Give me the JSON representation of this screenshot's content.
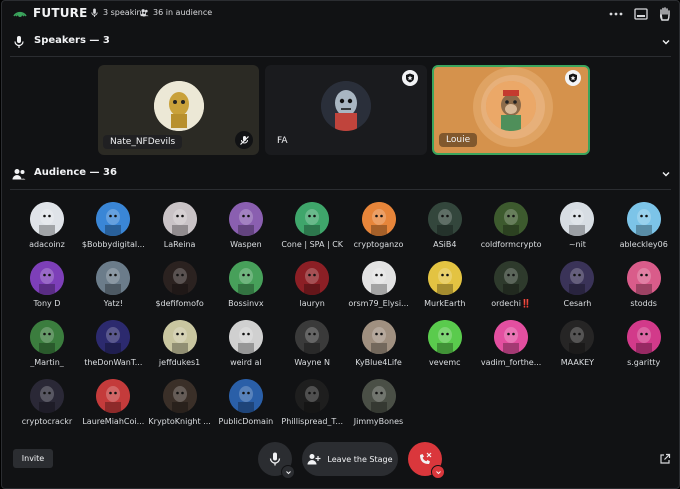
{
  "topbar": {
    "app_name": "FUTURE",
    "speaking": "3 speaking",
    "audience_count": "36 in audience"
  },
  "speakers_section": {
    "title": "Speakers — 3"
  },
  "speakers": [
    {
      "name": "Nate_NFDevils",
      "muted": true,
      "moderator": false,
      "background": "#2b2a24",
      "avatar_color": "#e8e2c8",
      "active": false
    },
    {
      "name": "FA",
      "muted": false,
      "moderator": true,
      "background": "#1a1b1e",
      "avatar_color": "#2a2f3a",
      "active": false
    },
    {
      "name": "Louie",
      "muted": false,
      "moderator": true,
      "background": "#d5924c",
      "avatar_color": "#e8a25e",
      "active": true,
      "active_border": "#3ba55d"
    }
  ],
  "audience_section": {
    "title": "Audience — 36"
  },
  "audience": [
    {
      "name": "adacoinz",
      "color": "#dfe3e8"
    },
    {
      "name": "$Bobbydigital...",
      "color": "#3a86d6"
    },
    {
      "name": "LaReina",
      "color": "#c9c3c6"
    },
    {
      "name": "Waspen",
      "color": "#8a5fb0"
    },
    {
      "name": "Cone | SPA | CK",
      "color": "#3fa66b"
    },
    {
      "name": "cryptoganzo",
      "color": "#e7853a"
    },
    {
      "name": "ASiB4",
      "color": "#33463c"
    },
    {
      "name": "coldformcrypto",
      "color": "#3d5a2e"
    },
    {
      "name": "~nit",
      "color": "#d7dde3"
    },
    {
      "name": "ableckley06",
      "color": "#7cc4e8"
    },
    {
      "name": "Tony D",
      "color": "#7d3fb8"
    },
    {
      "name": "Yatz!",
      "color": "#6b7c8a"
    },
    {
      "name": "$defifomofo",
      "color": "#2b2220"
    },
    {
      "name": "Bossinvx",
      "color": "#47a05a"
    },
    {
      "name": "lauryn",
      "color": "#8c1f25"
    },
    {
      "name": "orsm79_Elysi...",
      "color": "#e2e2e2"
    },
    {
      "name": "MurkEarth",
      "color": "#e3c342"
    },
    {
      "name": "ordechi‼️",
      "color": "#2e3a2c"
    },
    {
      "name": "Cesarh",
      "color": "#3a3358"
    },
    {
      "name": "stodds",
      "color": "#d95c8a"
    },
    {
      "name": "_Martin_",
      "color": "#3b7d3e"
    },
    {
      "name": "theDonWanT...",
      "color": "#2c2a6e"
    },
    {
      "name": "jeffdukes1",
      "color": "#c9c6a0"
    },
    {
      "name": "weird al",
      "color": "#d0d0d0"
    },
    {
      "name": "Wayne N",
      "color": "#3a3a3a"
    },
    {
      "name": "KyBlue4Life",
      "color": "#a09080"
    },
    {
      "name": "vevemc",
      "color": "#5acb4d"
    },
    {
      "name": "vadim_forthe...",
      "color": "#e34fa0"
    },
    {
      "name": "MAAKEY",
      "color": "#262525"
    },
    {
      "name": "s.garitty",
      "color": "#d23a8a"
    },
    {
      "name": "cryptocrackr",
      "color": "#2a2836"
    },
    {
      "name": "LaureMiahCoi...",
      "color": "#c43b3b"
    },
    {
      "name": "KryptoKnight ...",
      "color": "#3a2f28"
    },
    {
      "name": "PublicDomain",
      "color": "#2a5fa8"
    },
    {
      "name": "Phillispread_T...",
      "color": "#1e1e1e"
    },
    {
      "name": "JimmyBones",
      "color": "#4a4f46"
    }
  ],
  "controls": {
    "invite_label": "Invite",
    "leave_stage_label": "Leave the Stage"
  },
  "colors": {
    "background": "#111214",
    "hangup": "#da373c",
    "active_speaker": "#3ba55d",
    "brand": "#3ba55d"
  }
}
